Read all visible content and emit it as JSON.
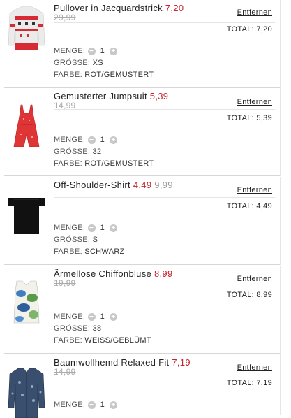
{
  "labels": {
    "remove": "Entfernen",
    "total": "TOTAL:",
    "quantity": "MENGE:",
    "size": "GRÖSSE:",
    "color": "FARBE:"
  },
  "items": [
    {
      "name": "Pullover in Jacquardstrick",
      "price": "7,20",
      "old_price": "29,99",
      "total": "7,20",
      "quantity": "1",
      "size": "XS",
      "color": "ROT/GEMUSTERT",
      "thumbnail_icon": "sweater-icon"
    },
    {
      "name": "Gemusterter Jumpsuit",
      "price": "5,39",
      "old_price": "14,99",
      "total": "5,39",
      "quantity": "1",
      "size": "32",
      "color": "ROT/GEMUSTERT",
      "thumbnail_icon": "jumpsuit-icon"
    },
    {
      "name": "Off-Shoulder-Shirt",
      "price": "4,49",
      "old_price": "9,99",
      "total": "4,49",
      "quantity": "1",
      "size": "S",
      "color": "SCHWARZ",
      "thumbnail_icon": "shirt-icon"
    },
    {
      "name": "Ärmellose Chiffonbluse",
      "price": "8,99",
      "old_price": "19,99",
      "total": "8,99",
      "quantity": "1",
      "size": "38",
      "color": "WEISS/GEBLÜMT",
      "thumbnail_icon": "blouse-icon"
    },
    {
      "name": "Baumwollhemd Relaxed Fit",
      "price": "7,19",
      "old_price": "14,99",
      "total": "7,19",
      "quantity": "1",
      "thumbnail_icon": "shirt-icon"
    }
  ],
  "colors": {
    "sale_price": "#c8232c",
    "stepper": "#c8c8c8"
  }
}
